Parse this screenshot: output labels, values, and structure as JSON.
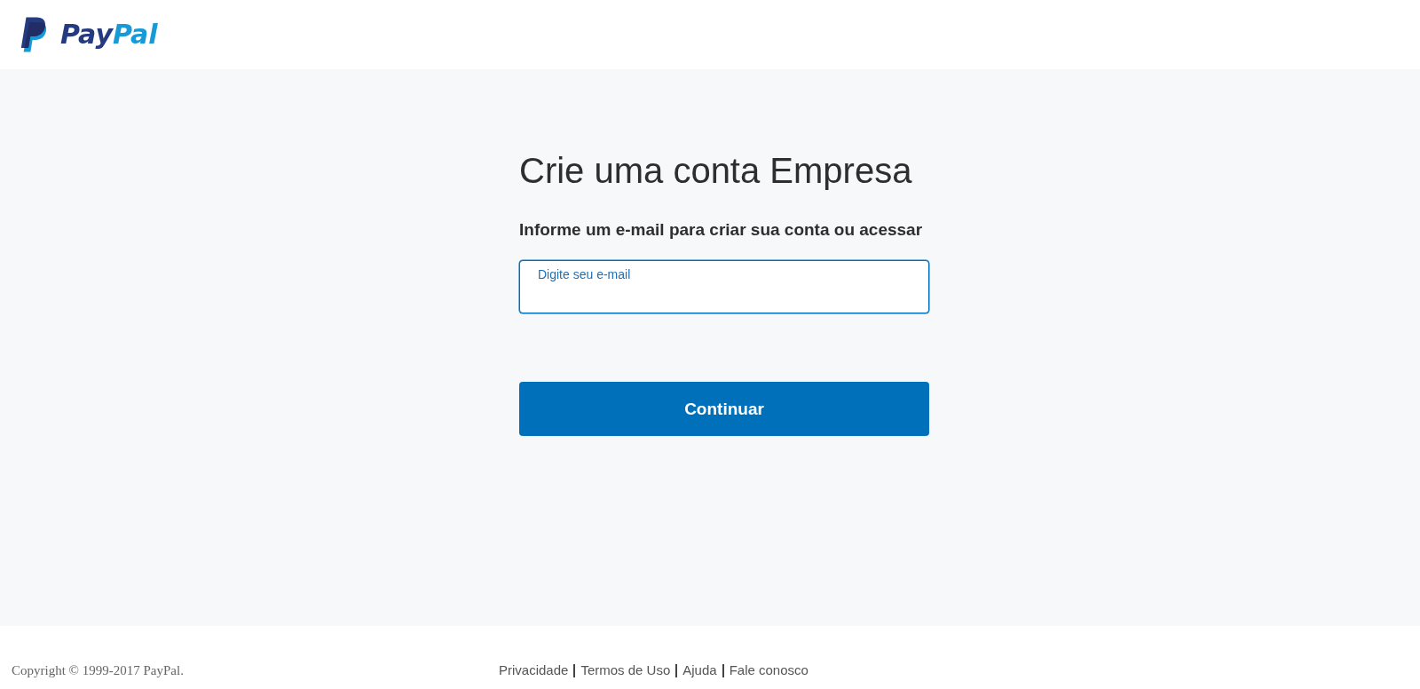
{
  "header": {
    "logo": {
      "wordmark": [
        "Pay",
        "Pal"
      ]
    }
  },
  "main": {
    "title": "Crie uma conta Empresa",
    "subtitle": "Informe um e-mail para criar sua conta ou acessar",
    "email_field": {
      "placeholder": "Digite seu e-mail",
      "focused": true
    },
    "continue_button": "Continuar"
  },
  "footer": {
    "copyright": "Copyright © 1999-2017 PayPal.",
    "links": [
      "Privacidade",
      "Termos de Uso",
      "Ajuda",
      "Fale conosco"
    ]
  }
}
